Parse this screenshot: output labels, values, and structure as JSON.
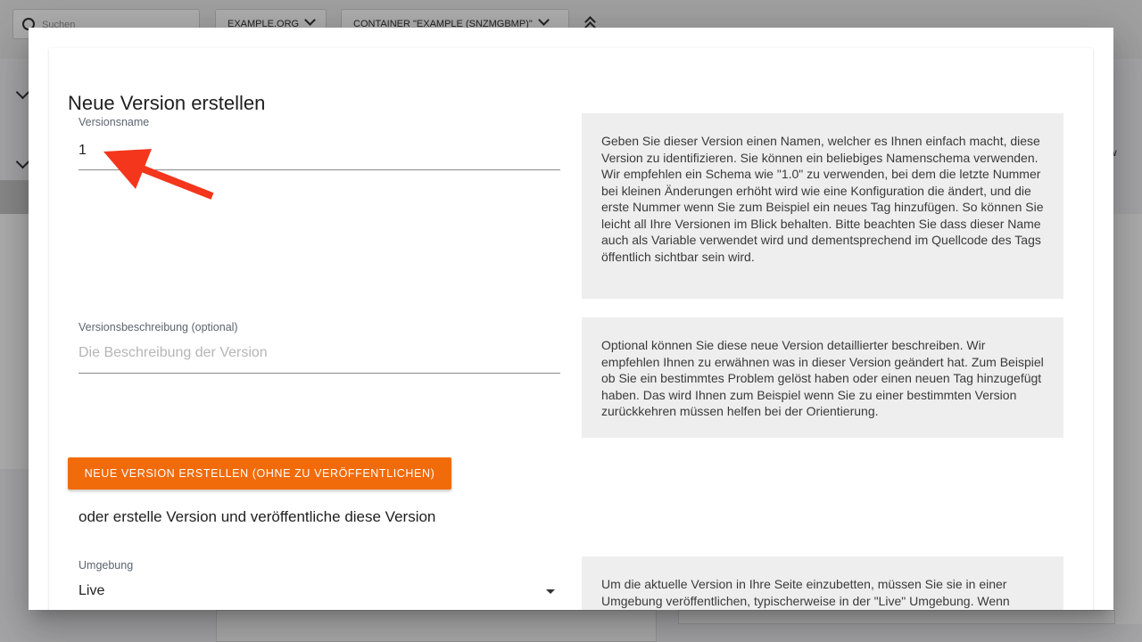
{
  "background": {
    "search_placeholder": "Suchen",
    "account_dropdown": "EXAMPLE.ORG",
    "container_dropdown": "CONTAINER \"EXAMPLE (SNZMGBMP)\"",
    "right_fragment": "w"
  },
  "dialog": {
    "title": "Neue Version erstellen",
    "version_name": {
      "label": "Versionsname",
      "value": "1",
      "help": "Geben Sie dieser Version einen Namen, welcher es Ihnen einfach macht, diese Version zu identifizieren. Sie können ein beliebiges Namenschema verwenden. Wir empfehlen ein Schema wie \"1.0\" zu verwenden, bei dem die letzte Nummer bei kleinen Änderungen erhöht wird wie eine Konfiguration die ändert, und die erste Nummer wenn Sie zum Beispiel ein neues Tag hinzufügen. So können Sie leicht all Ihre Versionen im Blick behalten. Bitte beachten Sie dass dieser Name auch als Variable verwendet wird und dementsprechend im Quellcode des Tags öffentlich sichtbar sein wird."
    },
    "version_description": {
      "label": "Versionsbeschreibung (optional)",
      "placeholder": "Die Beschreibung der Version",
      "value": "",
      "help": "Optional können Sie diese neue Version detaillierter beschreiben. Wir empfehlen Ihnen zu erwähnen was in dieser Version geändert hat. Zum Beispiel ob Sie ein bestimmtes Problem gelöst haben oder einen neuen Tag hinzugefügt haben. Das wird Ihnen zum Beispiel wenn Sie zu einer bestimmten Version zurückkehren müssen helfen bei der Orientierung."
    },
    "create_button": "NEUE VERSION ERSTELLEN (OHNE ZU VERÖFFENTLICHEN)",
    "alt_heading": "oder erstelle Version und veröffentliche diese Version",
    "environment": {
      "label": "Umgebung",
      "value": "Live",
      "help": "Um die aktuelle Version in Ihre Seite einzubetten, müssen Sie sie in einer Umgebung veröffentlichen, typischerweise in der \"Live\" Umgebung. Wenn"
    }
  },
  "colors": {
    "primary": "#f26b0a",
    "annotation": "#f4361c",
    "help_background": "#eeeeee"
  }
}
